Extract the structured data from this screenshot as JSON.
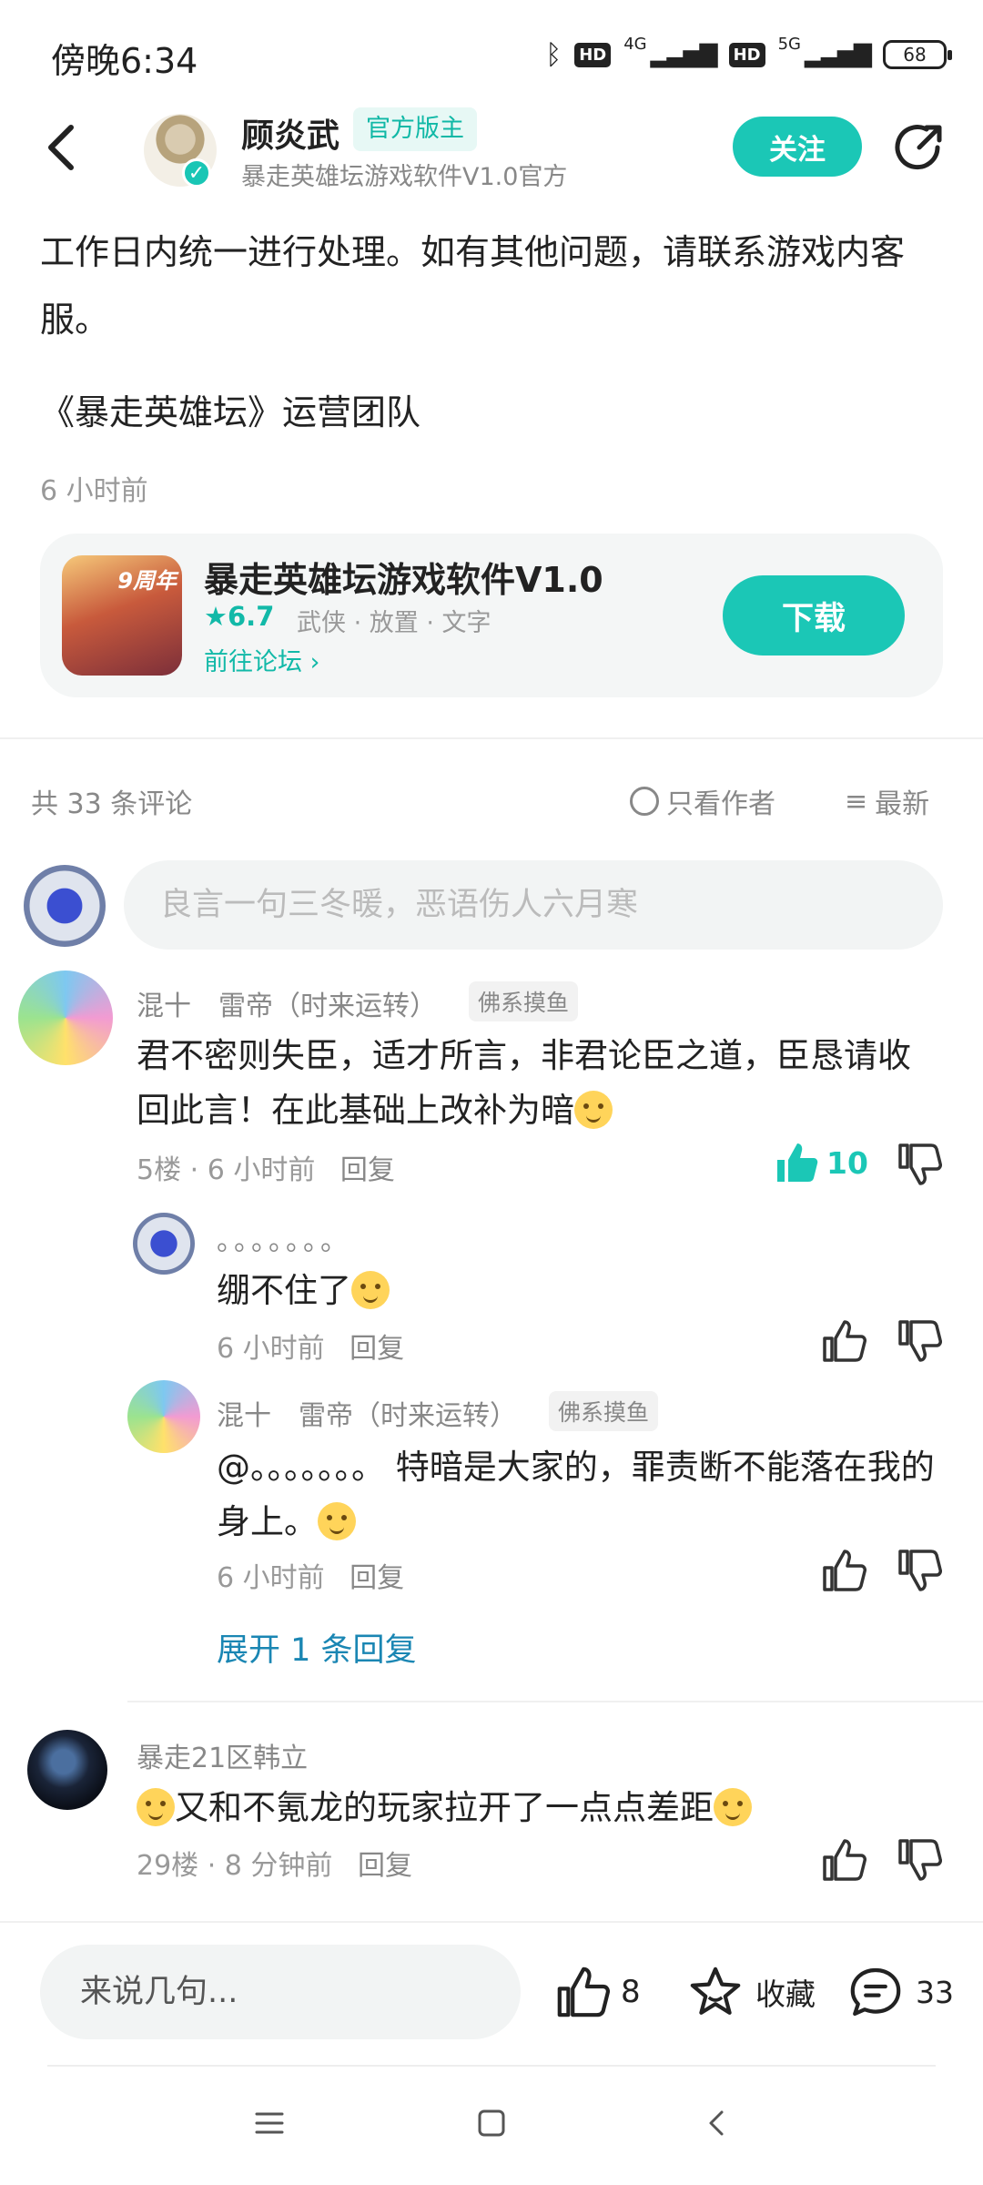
{
  "status_bar": {
    "time": "傍晚6:34",
    "net1": "4G",
    "net2": "5G",
    "hd": "HD",
    "battery": "68"
  },
  "header": {
    "author_name": "顾炎武",
    "author_badge": "官方版主",
    "author_subtitle": "暴走英雄坛游戏软件V1.0官方",
    "follow_label": "关注"
  },
  "post": {
    "text": "工作日内统一进行处理。如有其他问题，请联系游戏内客服。",
    "signature": "《暴走英雄坛》运营团队",
    "time": "6 小时前"
  },
  "game_card": {
    "name": "暴走英雄坛游戏软件V1.0",
    "rating": "★6.7",
    "tags": "武侠 · 放置 · 文字",
    "forum_link": "前往论坛 ›",
    "download_label": "下载",
    "icon_text": "9周年"
  },
  "comments_bar": {
    "count_label": "共 33 条评论",
    "only_author_label": "只看作者",
    "sort_label": "最新"
  },
  "comment_input": {
    "placeholder": "良言一句三冬暖，恶语伤人六月寒"
  },
  "comments": [
    {
      "user": "混十　雷帝（时来运转）",
      "tag": "佛系摸鱼",
      "text": "君不密则失臣，适才所言，非君论臣之道，臣恳请收回此言！在此基础上改补为暗",
      "floor": "5楼",
      "time": "6 小时前",
      "reply_label": "回复",
      "likes": "10",
      "replies": [
        {
          "user": "。。。。。。。",
          "text": "绷不住了",
          "time": "6 小时前",
          "reply_label": "回复"
        },
        {
          "user": "混十　雷帝（时来运转）",
          "tag": "佛系摸鱼",
          "text": "@。。。。。。。  特暗是大家的，罪责断不能落在我的身上。",
          "time": "6 小时前",
          "reply_label": "回复"
        }
      ],
      "expand_label": "展开 1 条回复"
    },
    {
      "user": "暴走21区韩立",
      "text": "又和不氪龙的玩家拉开了一点点差距",
      "floor": "29楼",
      "time": "8 分钟前",
      "reply_label": "回复"
    }
  ],
  "bottom_bar": {
    "input_placeholder": "来说几句...",
    "like_count": "8",
    "favorite_label": "收藏",
    "comment_count": "33"
  },
  "colors": {
    "accent": "#1bc7b6",
    "link": "#1a86b3",
    "muted": "#999999"
  }
}
